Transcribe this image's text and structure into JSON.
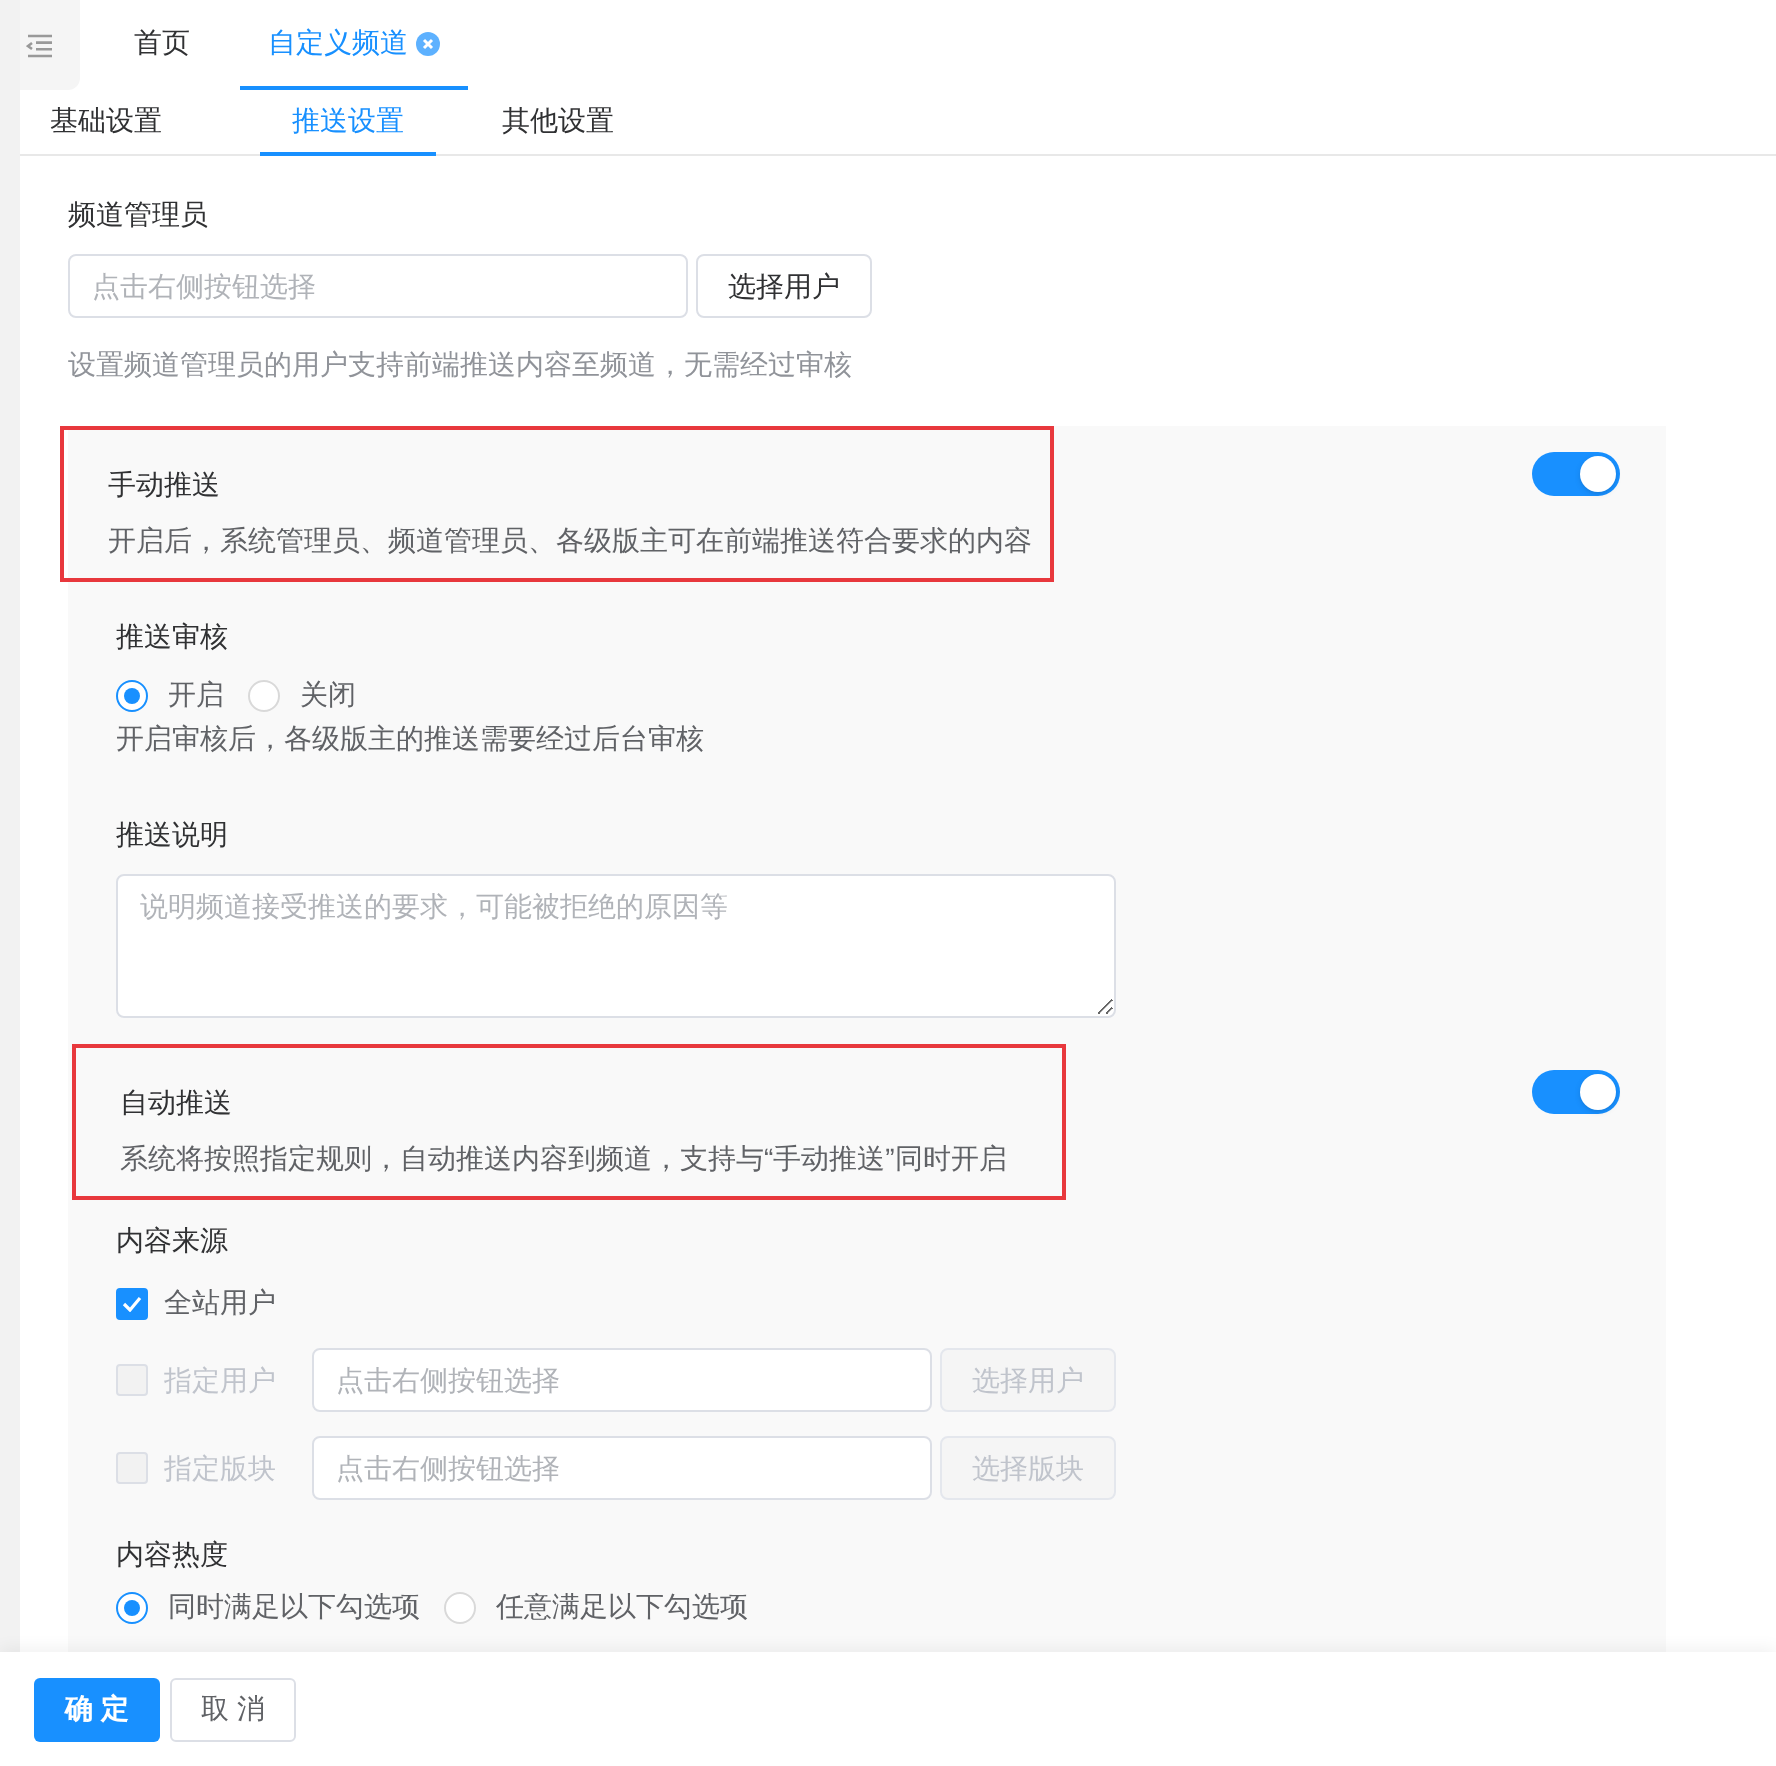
{
  "top_tabs": [
    {
      "label": "首页",
      "selected": false,
      "closable": false
    },
    {
      "label": "自定义频道",
      "selected": true,
      "closable": true
    }
  ],
  "sub_tabs": [
    {
      "label": "基础设置",
      "selected": false
    },
    {
      "label": "推送设置",
      "selected": true
    },
    {
      "label": "其他设置",
      "selected": false
    }
  ],
  "channel_admin": {
    "label": "频道管理员",
    "placeholder": "点击右侧按钮选择",
    "button": "选择用户",
    "hint": "设置频道管理员的用户支持前端推送内容至频道，无需经过审核"
  },
  "manual_push": {
    "title": "手动推送",
    "description": "开启后，系统管理员、频道管理员、各级版主可在前端推送符合要求的内容",
    "on": true,
    "highlighted": true
  },
  "push_review": {
    "label": "推送审核",
    "options": [
      {
        "label": "开启",
        "selected": true
      },
      {
        "label": "关闭",
        "selected": false
      }
    ],
    "hint": "开启审核后，各级版主的推送需要经过后台审核"
  },
  "push_note": {
    "label": "推送说明",
    "placeholder": "说明频道接受推送的要求，可能被拒绝的原因等"
  },
  "auto_push": {
    "title": "自动推送",
    "description": "系统将按照指定规则，自动推送内容到频道，支持与“手动推送”同时开启",
    "on": true,
    "highlighted": true
  },
  "content_source": {
    "label": "内容来源",
    "options": [
      {
        "kind": "plain",
        "label": "全站用户",
        "checked": true,
        "disabled": false
      },
      {
        "kind": "picker",
        "label": "指定用户",
        "checked": false,
        "disabled": true,
        "placeholder": "点击右侧按钮选择",
        "button": "选择用户"
      },
      {
        "kind": "picker",
        "label": "指定版块",
        "checked": false,
        "disabled": true,
        "placeholder": "点击右侧按钮选择",
        "button": "选择版块"
      }
    ]
  },
  "content_heat": {
    "label": "内容热度",
    "options": [
      {
        "label": "同时满足以下勾选项",
        "selected": true
      },
      {
        "label": "任意满足以下勾选项",
        "selected": false
      }
    ]
  },
  "footer": {
    "buttons": [
      {
        "label": "确 定",
        "kind": "primary"
      },
      {
        "label": "取 消",
        "kind": "default"
      }
    ]
  }
}
